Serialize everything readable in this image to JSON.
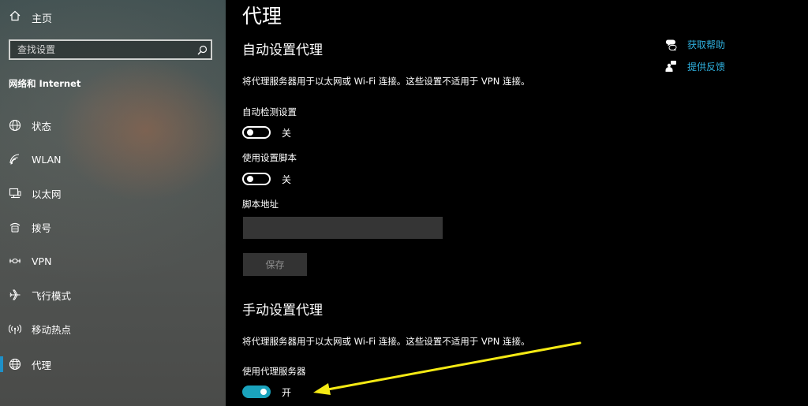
{
  "sidebar": {
    "home_label": "主页",
    "search_placeholder": "查找设置",
    "section_title": "网络和 Internet",
    "items": [
      {
        "label": "状态",
        "icon": "globe-status-icon"
      },
      {
        "label": "WLAN",
        "icon": "wifi-icon"
      },
      {
        "label": "以太网",
        "icon": "ethernet-icon"
      },
      {
        "label": "拨号",
        "icon": "dialup-icon"
      },
      {
        "label": "VPN",
        "icon": "vpn-icon"
      },
      {
        "label": "飞行模式",
        "icon": "airplane-icon"
      },
      {
        "label": "移动热点",
        "icon": "hotspot-icon"
      },
      {
        "label": "代理",
        "icon": "globe-icon",
        "active": true
      }
    ]
  },
  "main": {
    "title": "代理",
    "auto": {
      "heading": "自动设置代理",
      "description": "将代理服务器用于以太网或 Wi-Fi 连接。这些设置不适用于 VPN 连接。",
      "detect_label": "自动检测设置",
      "detect_state": "关",
      "script_label": "使用设置脚本",
      "script_state": "关",
      "address_label": "脚本地址",
      "address_value": "",
      "save_label": "保存"
    },
    "manual": {
      "heading": "手动设置代理",
      "description": "将代理服务器用于以太网或 Wi-Fi 连接。这些设置不适用于 VPN 连接。",
      "proxy_label": "使用代理服务器",
      "proxy_state": "开"
    },
    "links": {
      "help": "获取帮助",
      "feedback": "提供反馈"
    }
  },
  "colors": {
    "accent": "#1aa3bd",
    "link": "#2fb1df",
    "annotation_arrow": "#f5ea14"
  }
}
